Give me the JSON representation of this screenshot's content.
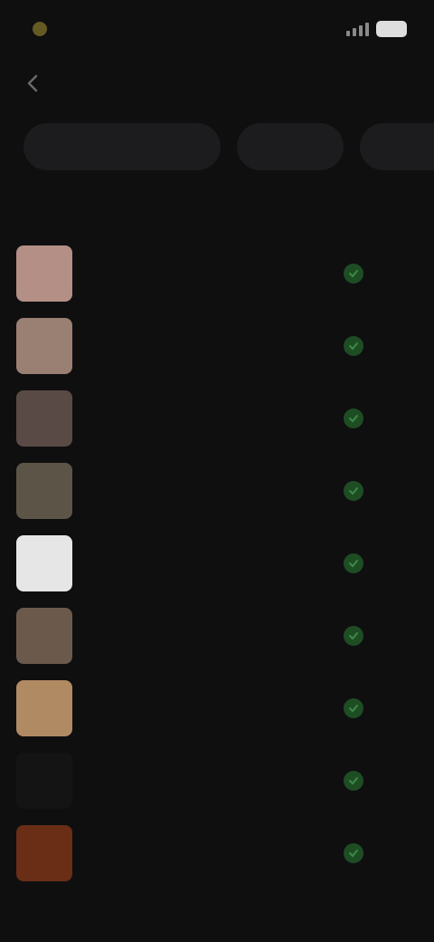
{
  "statusbar": {
    "time": "",
    "network": ""
  },
  "header": {
    "title": ""
  },
  "filters": [
    {
      "label": ""
    },
    {
      "label": ""
    },
    {
      "label": ""
    }
  ],
  "subheader": {
    "left": "",
    "right": ""
  },
  "items": [
    {
      "title": "",
      "subtitle": "",
      "status": "",
      "thumb_color": "#b48f86"
    },
    {
      "title": "",
      "subtitle": "",
      "status": "",
      "thumb_color": "#9a7f73"
    },
    {
      "title": "",
      "subtitle": "",
      "status": "",
      "thumb_color": "#5a4a45"
    },
    {
      "title": "",
      "subtitle": "",
      "status": "",
      "thumb_color": "#5c5547"
    },
    {
      "title": "",
      "subtitle": "",
      "status": "",
      "thumb_color": "#e6e6e6"
    },
    {
      "title": "",
      "subtitle": "",
      "status": "",
      "thumb_color": "#6b5a4c"
    },
    {
      "title": "",
      "subtitle": "",
      "status": "",
      "thumb_color": "#b08a62"
    },
    {
      "title": "",
      "subtitle": "",
      "status": "",
      "thumb_color": "#141414"
    },
    {
      "title": "",
      "subtitle": "",
      "status": "",
      "thumb_color": "#6a2d16"
    }
  ],
  "colors": {
    "background": "#0f0f10",
    "chip": "#1c1c1e",
    "accent": "#b79a2b",
    "success": "#1e4d24"
  },
  "icons": {
    "back": "chevron-left-icon",
    "status_check": "check-circle-icon"
  }
}
